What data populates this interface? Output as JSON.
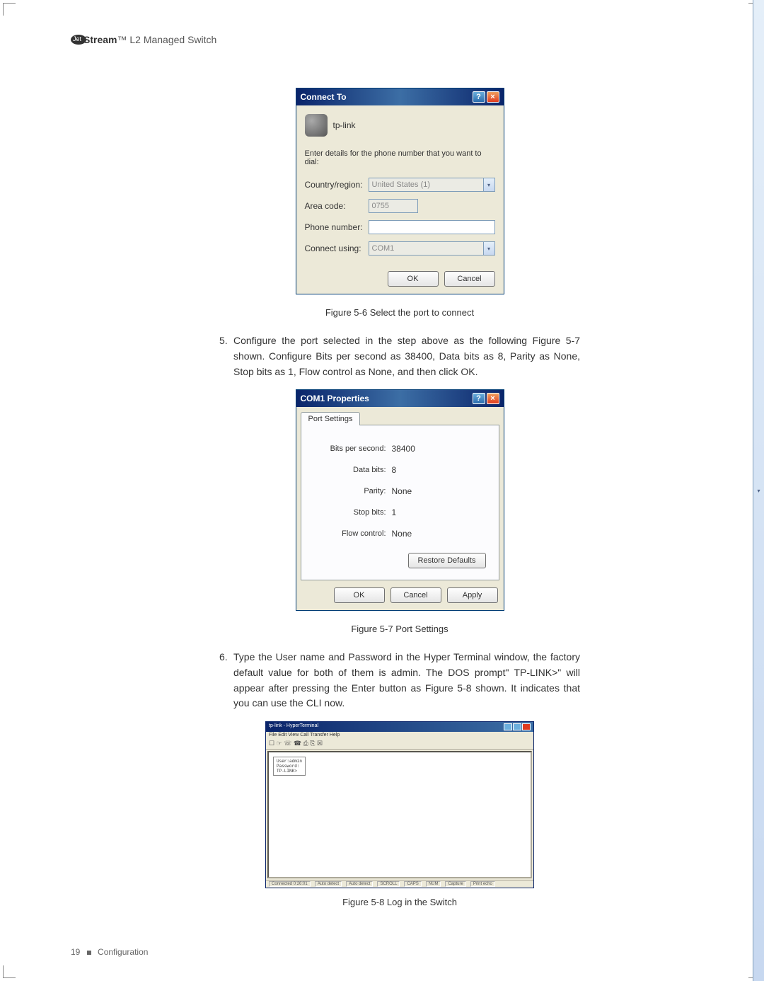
{
  "header": {
    "brand_suffix": "Stream",
    "tm": "™",
    "product": " L2 Managed Switch"
  },
  "connect_dialog": {
    "title": "Connect To",
    "logo_label": "tp-link",
    "instruction": "Enter details for the phone number that you want to dial:",
    "rows": {
      "country_label": "Country/region:",
      "country_value": "United States (1)",
      "area_label": "Area code:",
      "area_value": "0755",
      "phone_label": "Phone number:",
      "phone_value": "",
      "using_label": "Connect using:",
      "using_value": "COM1"
    },
    "ok": "OK",
    "cancel": "Cancel"
  },
  "caption1": "Figure 5-6  Select the port to connect",
  "step5": "Configure the port selected in the step above as the following Figure 5-7 shown. Configure Bits per second as 38400, Data bits as 8, Parity as None, Stop bits as 1, Flow control as None, and then click OK.",
  "props_dialog": {
    "title": "COM1 Properties",
    "tab": "Port Settings",
    "rows": {
      "bps_label": "Bits per second:",
      "bps_value": "38400",
      "data_label": "Data bits:",
      "data_value": "8",
      "parity_label": "Parity:",
      "parity_value": "None",
      "stop_label": "Stop bits:",
      "stop_value": "1",
      "flow_label": "Flow control:",
      "flow_value": "None"
    },
    "restore": "Restore Defaults",
    "ok": "OK",
    "cancel": "Cancel",
    "apply": "Apply"
  },
  "caption2": "Figure 5-7  Port Settings",
  "step6": "Type the User name and Password in the Hyper Terminal window, the factory default value for both of them is admin. The DOS prompt\" TP-LINK>\" will appear after pressing the Enter button as Figure 5-8 shown. It indicates that you can use the CLI now.",
  "terminal": {
    "title": "tp-link - HyperTerminal",
    "menu": "File  Edit  View  Call  Transfer  Help",
    "toolbar": "☐ ☞  ☏ ☎  ⎙ ⎘ ☒",
    "console_l1": "User:admin",
    "console_l2": "Password:",
    "console_l3": "TP-LINK>",
    "status": {
      "s1": "Connected 0:26:01",
      "s2": "Auto detect",
      "s3": "Auto detect",
      "s4": "SCROLL",
      "s5": "CAPS",
      "s6": "NUM",
      "s7": "Capture",
      "s8": "Print echo"
    }
  },
  "caption3": "Figure 5-8  Log in the Switch",
  "footer": {
    "page": "19",
    "section": "Configuration"
  }
}
